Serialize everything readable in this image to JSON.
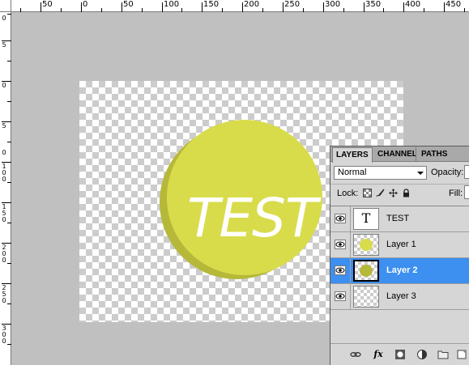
{
  "ruler": {
    "horizontal_labels": [
      "50",
      "0",
      "50",
      "100",
      "150",
      "200",
      "250",
      "300",
      "350",
      "400",
      "450"
    ],
    "vertical_labels": [
      "0",
      "5",
      "0",
      "5",
      "0",
      "1 0 0",
      "1 5 0",
      "2 0 0",
      "2 5 0",
      "3 0 0"
    ]
  },
  "canvas": {
    "text_layer_content": "TEST",
    "circle_color": "#d8dc4a",
    "shadow_color": "#b6b83a"
  },
  "layers_panel": {
    "tabs": [
      {
        "label": "LAYERS",
        "active": true
      },
      {
        "label": "CHANNELS",
        "active": false
      },
      {
        "label": "PATHS",
        "active": false
      }
    ],
    "blend_mode": "Normal",
    "opacity_label": "Opacity:",
    "lock_label": "Lock:",
    "fill_label": "Fill:",
    "layers": [
      {
        "name": "TEST",
        "thumb": "T",
        "visible": true,
        "selected": false
      },
      {
        "name": "Layer 1",
        "visible": true,
        "selected": false
      },
      {
        "name": "Layer 2",
        "visible": true,
        "selected": true
      },
      {
        "name": "Layer 3",
        "visible": true,
        "selected": false
      }
    ],
    "bottom_icons": [
      "link-icon",
      "fx-icon",
      "mask-icon",
      "adjustment-icon",
      "folder-icon",
      "new-layer-icon"
    ],
    "fx_label": "fx",
    "selected_color": "#3d8ff0"
  }
}
